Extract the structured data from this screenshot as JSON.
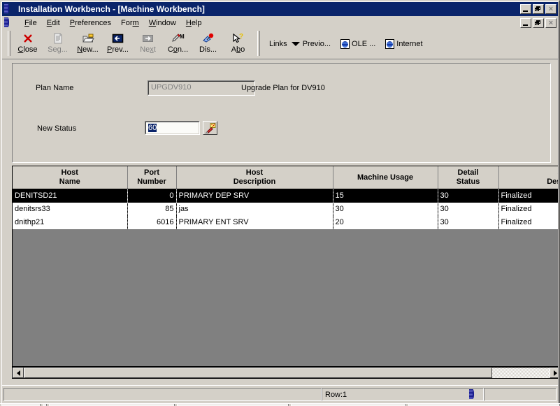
{
  "window": {
    "title": "Installation Workbench - [Machine Workbench]",
    "sys_icon": "globe-icon",
    "minimize_label": "_",
    "maximize_label": "□",
    "close_label": "×"
  },
  "menu": {
    "items": [
      {
        "label": "File",
        "accel": "F"
      },
      {
        "label": "Edit",
        "accel": "E"
      },
      {
        "label": "Preferences",
        "accel": "P"
      },
      {
        "label": "Form",
        "accel": "m"
      },
      {
        "label": "Window",
        "accel": "W"
      },
      {
        "label": "Help",
        "accel": "H"
      }
    ]
  },
  "toolbar": {
    "buttons": [
      {
        "label": "Close",
        "icon": "close-x-icon",
        "disabled": false
      },
      {
        "label": "Seg...",
        "icon": "segment-document-icon",
        "disabled": true
      },
      {
        "label": "New...",
        "icon": "new-folder-icon",
        "disabled": false
      },
      {
        "label": "Prev...",
        "icon": "previous-arrow-icon",
        "disabled": false
      },
      {
        "label": "Next",
        "icon": "next-arrow-icon",
        "disabled": true
      },
      {
        "label": "Con...",
        "icon": "pencil-m-icon",
        "disabled": false
      },
      {
        "label": "Dis...",
        "icon": "display-pin-icon",
        "disabled": false
      },
      {
        "label": "Abo",
        "icon": "arrow-question-icon",
        "disabled": false
      }
    ],
    "links_label": "Links",
    "links": [
      {
        "label": "Previo...",
        "icon": "chevron-down-icon"
      },
      {
        "label": "OLE ...",
        "icon": "ole-document-icon"
      },
      {
        "label": "Internet",
        "icon": "internet-document-icon"
      }
    ]
  },
  "form": {
    "plan_name_label": "Plan Name",
    "plan_name_value": "UPGDV910",
    "plan_description": "Upgrade Plan for DV910",
    "new_status_label": "New Status",
    "new_status_value": "60",
    "visual_assist_icon": "flashlight-icon"
  },
  "grid": {
    "columns": [
      "Host\nName",
      "Port\nNumber",
      "Host\nDescription",
      "Machine Usage",
      "Detail\nStatus",
      "St\nDesc"
    ],
    "rows": [
      {
        "selected": true,
        "cells": [
          "DENITSD21",
          "0",
          "PRIMARY DEP SRV",
          "15",
          "30",
          "Finalized"
        ]
      },
      {
        "selected": false,
        "cells": [
          "denitsrs33",
          "85",
          "jas",
          "30",
          "30",
          "Finalized"
        ]
      },
      {
        "selected": false,
        "cells": [
          "dnithp21",
          "6016",
          "PRIMARY ENT SRV",
          "20",
          "30",
          "Finalized"
        ]
      }
    ],
    "hscroll": {
      "left_arrow": "scroll-left-icon",
      "right_arrow": "scroll-right-icon"
    }
  },
  "statusbar": {
    "pane_left": "",
    "row_text": "Row:1",
    "status_icon": "globe-icon",
    "pane_right": ""
  },
  "colors": {
    "titlebar": "#0a246a",
    "face": "#d4d0c8",
    "grid_empty": "#808080",
    "selection_bg": "#000000",
    "accent_red": "#cc0000"
  }
}
